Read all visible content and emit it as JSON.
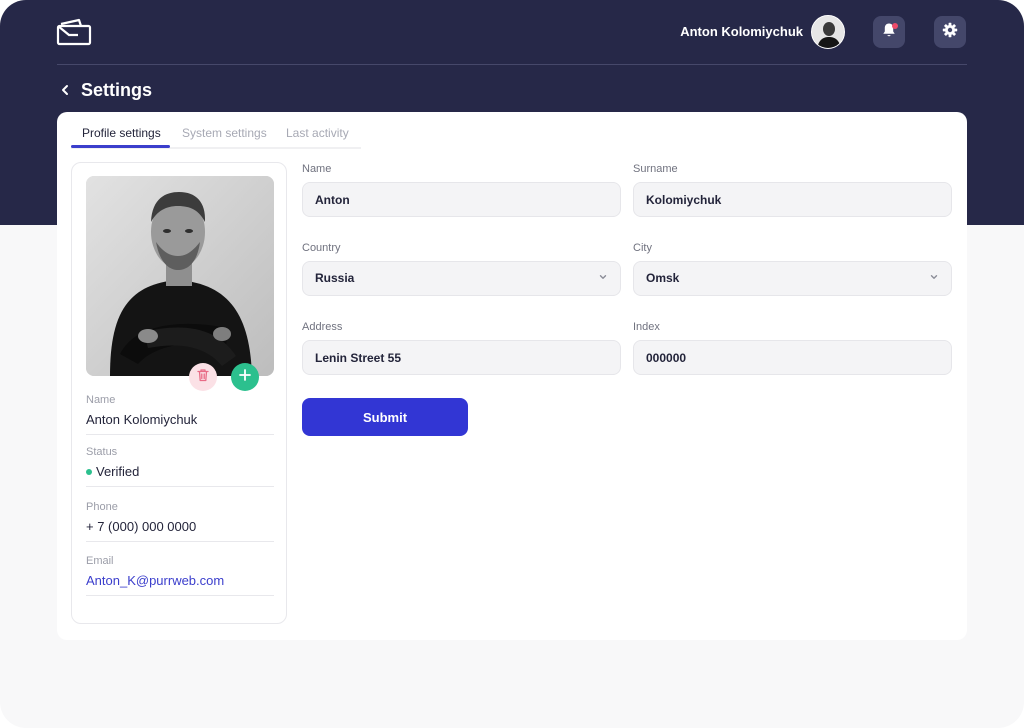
{
  "header": {
    "user_name": "Anton Kolomiychuk"
  },
  "page": {
    "title": "Settings"
  },
  "tabs": [
    {
      "label": "Profile settings",
      "active": true
    },
    {
      "label": "System settings",
      "active": false
    },
    {
      "label": "Last activity",
      "active": false
    }
  ],
  "profile": {
    "name_label": "Name",
    "name_value": "Anton Kolomiychuk",
    "status_label": "Status",
    "status_value": "Verified",
    "phone_label": "Phone",
    "phone_value": "+ 7 (000) 000 0000",
    "email_label": "Email",
    "email_value": "Anton_K@purrweb.com"
  },
  "form": {
    "name_label": "Name",
    "name_value": "Anton",
    "surname_label": "Surname",
    "surname_value": "Kolomiychuk",
    "country_label": "Country",
    "country_value": "Russia",
    "city_label": "City",
    "city_value": "Omsk",
    "address_label": "Address",
    "address_value": "Lenin Street 55",
    "index_label": "Index",
    "index_value": "000000",
    "submit_label": "Submit"
  },
  "colors": {
    "header_bg": "#262848",
    "accent": "#3236d4",
    "success": "#2cc08e",
    "danger": "#ee4b6a"
  },
  "icons": [
    "wallet-logo-icon",
    "bell-icon",
    "gear-icon",
    "chevron-left-icon",
    "chevron-down-icon",
    "trash-icon",
    "plus-icon"
  ]
}
